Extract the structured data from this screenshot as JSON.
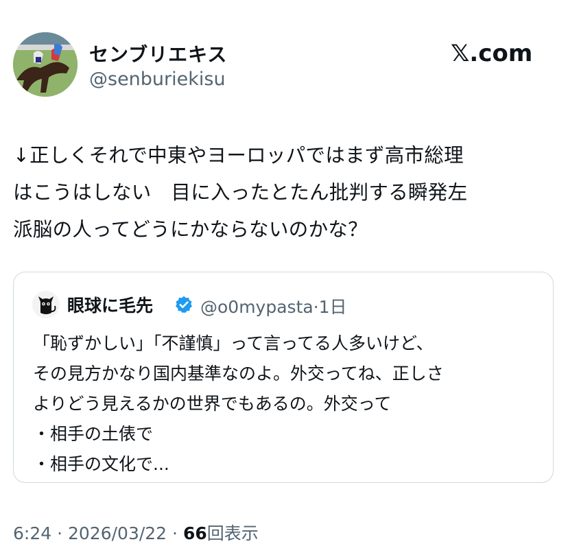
{
  "author": {
    "name": "センブリエキス",
    "handle": "@senburiekisu"
  },
  "brand": "𝕏.com",
  "tweet": {
    "text": "↓正しくそれで中東やヨーロッパではまず高市総理\nはこうはしない　目に入ったとたん批判する瞬発左\n派脳の人ってどうにかならないのかな？"
  },
  "quote": {
    "name": "眼球に毛先",
    "handle": "@o0mypasta",
    "separator": "·",
    "age": "1日",
    "text": "「恥ずかしい」「不謹慎」って言ってる人多いけど、\nその見方かなり国内基準なのよ。外交ってね、正しさ\nよりどう見えるかの世界でもあるの。外交って\n・相手の土俵で\n・相手の文化で..."
  },
  "footer": {
    "time": "6:24",
    "sep1": "·",
    "date": "2026/03/22",
    "sep2": "·",
    "views": "66",
    "views_label": "回表示"
  },
  "colors": {
    "text": "#0f1419",
    "secondary": "#536471",
    "border": "#cfd9de",
    "verified": "#1d9bf0"
  }
}
